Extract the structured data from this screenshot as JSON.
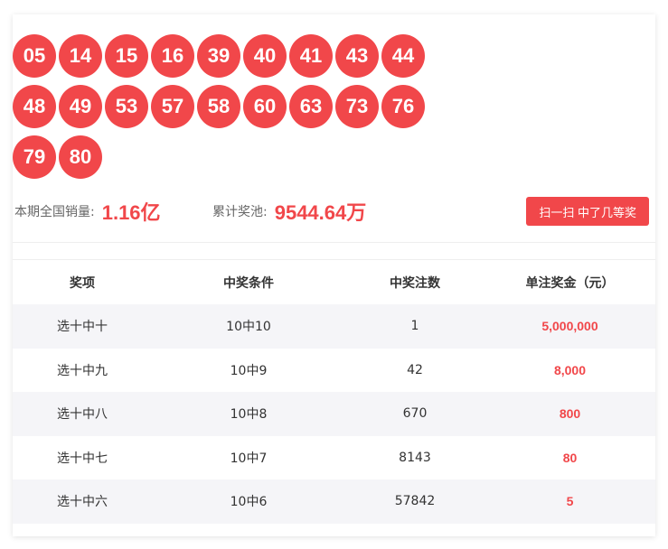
{
  "colors": {
    "accent_red": "#f1474a",
    "alt_row_bg": "#f5f5f8"
  },
  "numbers": {
    "rows": [
      [
        "05",
        "14",
        "15",
        "16",
        "39",
        "40",
        "41",
        "43",
        "44"
      ],
      [
        "48",
        "49",
        "53",
        "57",
        "58",
        "60",
        "63",
        "73",
        "76"
      ],
      [
        "79",
        "80"
      ]
    ]
  },
  "stats": {
    "sales_label": "本期全国销量:",
    "sales_value": "1.16亿",
    "pool_label": "累计奖池:",
    "pool_value": "9544.64万"
  },
  "scan_button_label": "扫一扫 中了几等奖",
  "table": {
    "headers": [
      "奖项",
      "中奖条件",
      "中奖注数",
      "单注奖金（元）"
    ],
    "rows": [
      {
        "prize_level": "选十中十",
        "condition": "10中10",
        "winners": "1",
        "amount": "5,000,000"
      },
      {
        "prize_level": "选十中九",
        "condition": "10中9",
        "winners": "42",
        "amount": "8,000"
      },
      {
        "prize_level": "选十中八",
        "condition": "10中8",
        "winners": "670",
        "amount": "800"
      },
      {
        "prize_level": "选十中七",
        "condition": "10中7",
        "winners": "8143",
        "amount": "80"
      },
      {
        "prize_level": "选十中六",
        "condition": "10中6",
        "winners": "57842",
        "amount": "5"
      }
    ]
  }
}
